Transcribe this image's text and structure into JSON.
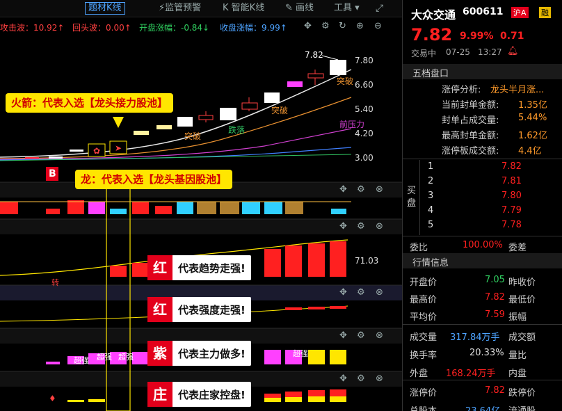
{
  "toolbar": {
    "theme_kline": "题材K线",
    "monitor": "监管预警",
    "smart_kline": "智能K线",
    "draw": "画线",
    "tools": "工具"
  },
  "indicators": {
    "attack_wave": "攻击波：10.92↑",
    "return_wave": "回头波：0.00↑",
    "open_change": "开盘涨幅：-0.84↓",
    "close_change": "收盘涨幅：9.99↑"
  },
  "price_axis": [
    "7.80",
    "6.60",
    "5.40",
    "4.20",
    "3.00"
  ],
  "chart_labels": {
    "high_tag": "7.82",
    "breakout1": "突破",
    "breakout2": "突破",
    "breakout3": "突破",
    "fall": "跌落",
    "resistance": "前压力",
    "buy_mark": "B",
    "sub1_value": "71.03",
    "sub1_mark": "转",
    "super1": "超强",
    "super2": "超强",
    "super3": "超强",
    "super4": "超强",
    "sub4_mark": "♦"
  },
  "callouts": {
    "rocket": "火箭：代表入选【龙头接力股池】",
    "dragon": "龙：代表入选【龙头基因股池】"
  },
  "badges": [
    {
      "key": "红",
      "text": "代表趋势走强!"
    },
    {
      "key": "红",
      "text": "代表强度走强!"
    },
    {
      "key": "紫",
      "text": "代表主力做多!"
    },
    {
      "key": "庄",
      "text": "代表庄家控盘!"
    }
  ],
  "stock": {
    "name": "大众交通",
    "code": "600611",
    "market": "沪A",
    "margin": "融",
    "price": "7.82",
    "change_pct": "9.99%",
    "change": "0.71",
    "status": "交易中",
    "date": "07-25",
    "time": "13:27"
  },
  "order_book": {
    "title": "五档盘口",
    "analysis_label": "涨停分析:",
    "analysis_value": "龙头半月涨...",
    "stats": [
      {
        "label": "当前封单金额:",
        "value": "1.35亿"
      },
      {
        "label": "封单占成交量:",
        "value": "5.44%"
      },
      {
        "label": "最高封单金额:",
        "value": "1.62亿"
      },
      {
        "label": "涨停板成交额:",
        "value": "4.4亿"
      }
    ],
    "buy_label": "买盘",
    "buy_levels": [
      {
        "level": "1",
        "price": "7.82"
      },
      {
        "level": "2",
        "price": "7.81"
      },
      {
        "level": "3",
        "price": "7.80"
      },
      {
        "level": "4",
        "price": "7.79"
      },
      {
        "level": "5",
        "price": "7.78"
      }
    ],
    "ratio_label": "委比",
    "ratio_value": "100.00%",
    "diff_label": "委差"
  },
  "quote": {
    "title": "行情信息",
    "rows": [
      {
        "l1": "开盘价",
        "v1": "7.05",
        "l2": "昨收价"
      },
      {
        "l1": "最高价",
        "v1": "7.82",
        "l2": "最低价"
      },
      {
        "l1": "平均价",
        "v1": "7.59",
        "l2": "振幅"
      },
      {
        "l1": "成交量",
        "v1": "317.84万手",
        "l2": "成交额"
      },
      {
        "l1": "换手率",
        "v1": "20.33%",
        "l2": "量比"
      },
      {
        "l1": "外盘",
        "v1": "168.24万手",
        "l2": "内盘"
      },
      {
        "l1": "涨停价",
        "v1": "7.82",
        "l2": "跌停价"
      },
      {
        "l1": "总股本",
        "v1": "23.64亿",
        "l2": "流通股"
      }
    ]
  },
  "colors": {
    "up": "#ff2020",
    "down": "#00c060",
    "accent": "#4da3ff",
    "highlight": "#ffe600"
  }
}
